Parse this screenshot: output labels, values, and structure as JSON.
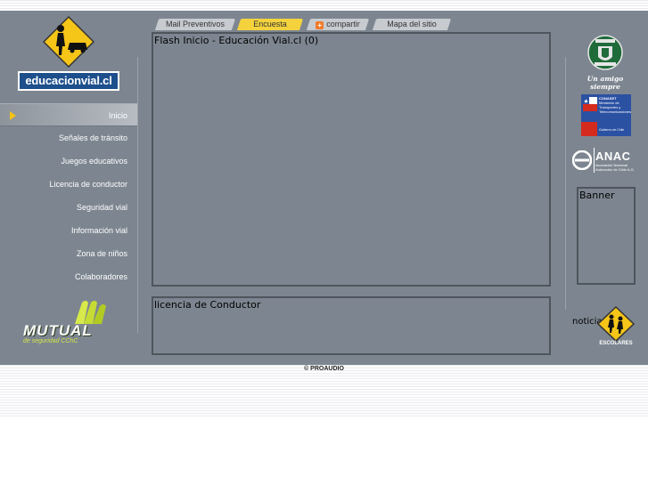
{
  "logo": {
    "text": "educacionvial.cl"
  },
  "nav": {
    "items": [
      {
        "label": "Inicio",
        "active": true
      },
      {
        "label": "Señales de tránsito"
      },
      {
        "label": "Juegos educativos"
      },
      {
        "label": "Licencia de conductor"
      },
      {
        "label": "Seguridad vial"
      },
      {
        "label": "Información vial"
      },
      {
        "label": "Zona de niños"
      },
      {
        "label": "Colaboradores"
      }
    ]
  },
  "tabs": [
    {
      "label": "Mail Preventivos"
    },
    {
      "label": "Encuesta",
      "active": true
    },
    {
      "label": "compartir"
    },
    {
      "label": "Mapa del sitio"
    }
  ],
  "panels": {
    "flash": "Flash Inicio - Educación Vial.cl (0)",
    "licencia": "licencia de Conductor",
    "banner": "Banner"
  },
  "right": {
    "carabineros_caption": "Un amigo siempre",
    "conaset_text": [
      "CONASET",
      "Ministerio de",
      "Transportes y",
      "Telecomunicaciones"
    ],
    "conaset_footer": "Gobierno de Chile",
    "anac_title": "ANAC",
    "anac_sub": [
      "Asociación Nacional",
      "Automotriz de Chile A.G."
    ],
    "noticias": "noticias",
    "escolares_caption": "ESCOLARES"
  },
  "mutual": {
    "title": "MUTUAL",
    "subtitle": "de seguridad CChC"
  },
  "footer": {
    "copyright": "© PROAUDIO"
  },
  "colors": {
    "band": "#7d8690",
    "accent": "#f3c21a",
    "logo_blue": "#1d4f8c"
  }
}
